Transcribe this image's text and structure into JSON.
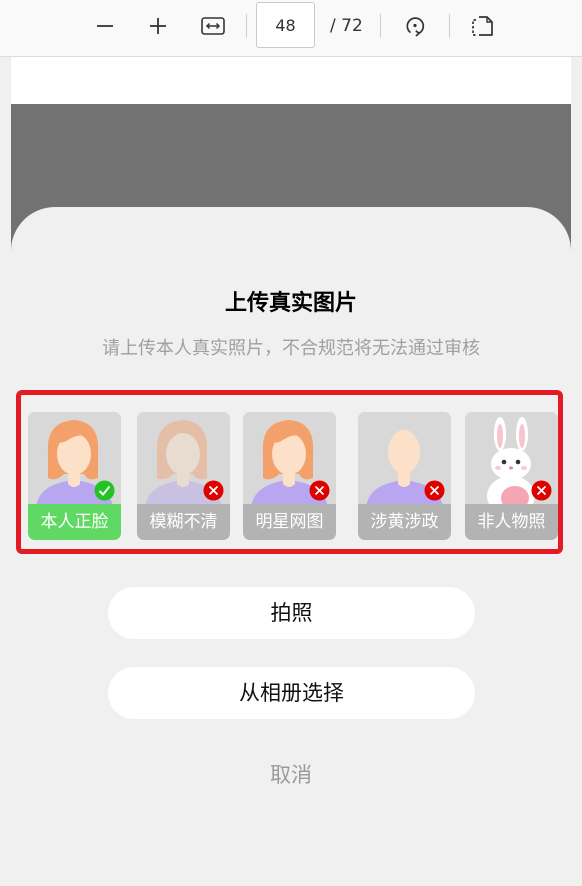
{
  "toolbar": {
    "page_current": "48",
    "page_total": "/ 72",
    "icons": [
      "zoom-out-icon",
      "zoom-in-icon",
      "fit-width-icon",
      "rotate-icon",
      "page-view-icon"
    ]
  },
  "sheet": {
    "title": "上传真实图片",
    "subtitle": "请上传本人真实照片，不合规范将无法通过审核",
    "examples": [
      {
        "label": "本人正脸",
        "status": "correct"
      },
      {
        "label": "模糊不清",
        "status": "wrong"
      },
      {
        "label": "明星网图",
        "status": "wrong"
      },
      {
        "label": "涉黄涉政",
        "status": "wrong"
      },
      {
        "label": "非人物照",
        "status": "wrong"
      }
    ],
    "take_photo_label": "拍照",
    "choose_album_label": "从相册选择",
    "cancel_label": "取消"
  },
  "colors": {
    "highlight": "#e51b24",
    "correct": "#5fd964",
    "wrong_badge": "#e00000",
    "overlay": "#727272"
  }
}
